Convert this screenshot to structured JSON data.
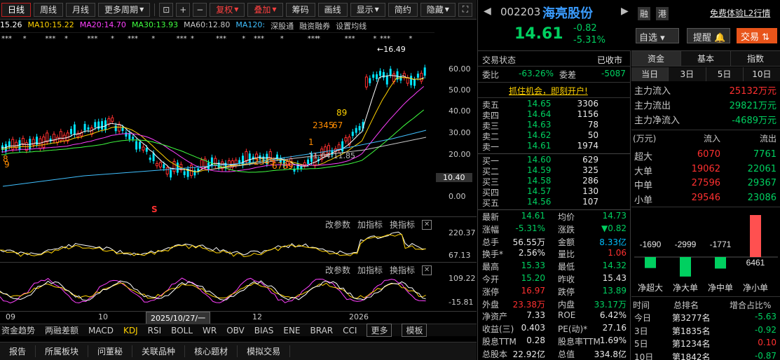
{
  "toolbar": {
    "buttons": [
      "日线",
      "周线",
      "月线",
      "更多周期"
    ],
    "fuquan": "复权",
    "diejia": "叠加",
    "buttons2": [
      "筹码",
      "画线",
      "显示",
      "简约",
      "隐藏"
    ]
  },
  "ma_legend": [
    {
      "text": "15.26",
      "color": "#ffffff"
    },
    {
      "text": "MA10:15.22",
      "color": "#ffd200"
    },
    {
      "text": "MA20:14.70",
      "color": "#ff40ff"
    },
    {
      "text": "MA30:13.93",
      "color": "#40ff40"
    },
    {
      "text": "MA60:12.80",
      "color": "#c8c8c8"
    },
    {
      "text": "MA120:",
      "color": "#40c0ff"
    },
    {
      "text": "深股通",
      "color": "#c8c8c8"
    },
    {
      "text": "融资融券",
      "color": "#c8c8c8"
    },
    {
      "text": "设置均线",
      "color": "#c8c8c8"
    }
  ],
  "main_chart": {
    "y_ticks": [
      "60.00",
      "50.00",
      "40.00",
      "30.00",
      "20.00",
      "10.40",
      "0.00"
    ],
    "high_label": "16.49",
    "low_label": "11.64-11.85",
    "tdcount_labels": [
      "8",
      "9",
      "89",
      "2345",
      "67",
      "2345",
      "6789",
      "1"
    ],
    "marker": "S"
  },
  "sub1": {
    "buttons": [
      "改参数",
      "加指标",
      "换指标"
    ],
    "ticks": [
      "220.37",
      "67.13"
    ]
  },
  "sub2": {
    "buttons": [
      "改参数",
      "加指标",
      "换指标"
    ],
    "ticks": [
      "109.22",
      "-15.81"
    ]
  },
  "x_axis": {
    "labels": [
      "09",
      "10",
      "2025/10/27/一",
      "12",
      "2026"
    ]
  },
  "indicator_tabs": [
    "资金趋势",
    "两融差额",
    "MACD",
    "KDJ",
    "RSI",
    "BOLL",
    "WR",
    "OBV",
    "BIAS",
    "ENE",
    "BRAR",
    "CCI",
    "更多",
    "模板"
  ],
  "active_indicator": "KDJ",
  "bottom_tabs": [
    "报告",
    "所属板块",
    "问董秘",
    "关联品种",
    "核心题材",
    "模拟交易"
  ],
  "stock": {
    "code": "002203",
    "name": "海亮股份",
    "tag1": "融",
    "tag2": "港",
    "l2": "免费体验L2行情",
    "price": "14.61",
    "change": "-0.82",
    "pct": "-5.31%",
    "btn_zixuan": "自选",
    "btn_tixing": "提醒",
    "btn_jiaoyi": "交易"
  },
  "status": {
    "label": "交易状态",
    "value": "已收市"
  },
  "weibi": {
    "label": "委比",
    "value": "-63.26%",
    "label2": "委差",
    "value2": "-5087"
  },
  "promo": "抓住机会，即刻开户!",
  "sells": [
    {
      "label": "卖五",
      "price": "14.65",
      "vol": "3306"
    },
    {
      "label": "卖四",
      "price": "14.64",
      "vol": "1156"
    },
    {
      "label": "卖三",
      "price": "14.63",
      "vol": "78"
    },
    {
      "label": "卖二",
      "price": "14.62",
      "vol": "50"
    },
    {
      "label": "卖一",
      "price": "14.61",
      "vol": "1974"
    }
  ],
  "buys": [
    {
      "label": "买一",
      "price": "14.60",
      "vol": "629"
    },
    {
      "label": "买二",
      "price": "14.59",
      "vol": "325"
    },
    {
      "label": "买三",
      "price": "14.58",
      "vol": "286"
    },
    {
      "label": "买四",
      "price": "14.57",
      "vol": "130"
    },
    {
      "label": "买五",
      "price": "14.56",
      "vol": "107"
    }
  ],
  "quote": [
    {
      "l": "最新",
      "v": "14.61",
      "vc": "green",
      "l2": "均价",
      "v2": "14.73",
      "v2c": "green"
    },
    {
      "l": "涨幅",
      "v": "-5.31%",
      "vc": "green",
      "l2": "涨跌",
      "v2": "▼0.82",
      "v2c": "green"
    },
    {
      "l": "总手",
      "v": "56.55万",
      "vc": "white",
      "l2": "金额",
      "v2": "8.33亿",
      "v2c": "cyan"
    },
    {
      "l": "换手*",
      "v": "2.56%",
      "vc": "white",
      "l2": "量比",
      "v2": "1.06",
      "v2c": "red"
    },
    {
      "l": "最高",
      "v": "15.33",
      "vc": "green",
      "l2": "最低",
      "v2": "14.32",
      "v2c": "green"
    },
    {
      "l": "今开",
      "v": "15.20",
      "vc": "green",
      "l2": "昨收",
      "v2": "15.43",
      "v2c": "white"
    },
    {
      "l": "涨停",
      "v": "16.97",
      "vc": "red",
      "l2": "跌停",
      "v2": "13.89",
      "v2c": "green"
    },
    {
      "l": "外盘",
      "v": "23.38万",
      "vc": "red",
      "l2": "内盘",
      "v2": "33.17万",
      "v2c": "green"
    },
    {
      "l": "净资产",
      "v": "7.33",
      "vc": "white",
      "l2": "ROE",
      "v2": "6.42%",
      "v2c": "white"
    },
    {
      "l": "收益(三)",
      "v": "0.403",
      "vc": "white",
      "l2": "PE(动)*",
      "v2": "27.16",
      "v2c": "white"
    },
    {
      "l": "股息TTM",
      "v": "0.28",
      "vc": "white",
      "l2": "股息率TTM",
      "v2": "1.69%",
      "v2c": "white"
    },
    {
      "l": "总股本",
      "v": "22.92亿",
      "vc": "white",
      "l2": "总值",
      "v2": "334.8亿",
      "v2c": "white"
    }
  ],
  "fund_tabs": [
    "资金",
    "基本",
    "指数"
  ],
  "period_tabs": [
    "当日",
    "3日",
    "5日",
    "10日"
  ],
  "flows": [
    {
      "l": "主力流入",
      "v": "25132万元",
      "c": "red"
    },
    {
      "l": "主力流出",
      "v": "29821万元",
      "c": "green"
    },
    {
      "l": "主力净流入",
      "v": "-4689万元",
      "c": "green"
    }
  ],
  "flow_table": {
    "head": [
      "(万元)",
      "流入",
      "流出"
    ],
    "rows": [
      {
        "l": "超大",
        "in": "6070",
        "out": "7761"
      },
      {
        "l": "大单",
        "in": "19062",
        "out": "22061"
      },
      {
        "l": "中单",
        "in": "27596",
        "out": "29367"
      },
      {
        "l": "小单",
        "in": "29546",
        "out": "23086"
      }
    ]
  },
  "net_bars": {
    "values": [
      -1690,
      -2999,
      -1771,
      6461
    ],
    "labels": [
      "净超大",
      "净大单",
      "净中单",
      "净小单"
    ]
  },
  "rank_table": {
    "head": [
      "时间",
      "总排名",
      "增合占比%"
    ],
    "rows": [
      {
        "t": "今日",
        "r": "第3277名",
        "p": "-5.63",
        "c": "green"
      },
      {
        "t": "3日",
        "r": "第1835名",
        "p": "-0.92",
        "c": "green"
      },
      {
        "t": "5日",
        "r": "第1234名",
        "p": "0.10",
        "c": "red"
      },
      {
        "t": "10日",
        "r": "第1842名",
        "p": "-0.87",
        "c": "green"
      }
    ]
  },
  "colors": {
    "up": "#ff3030",
    "down": "#00d060",
    "accent": "#ffd200"
  }
}
